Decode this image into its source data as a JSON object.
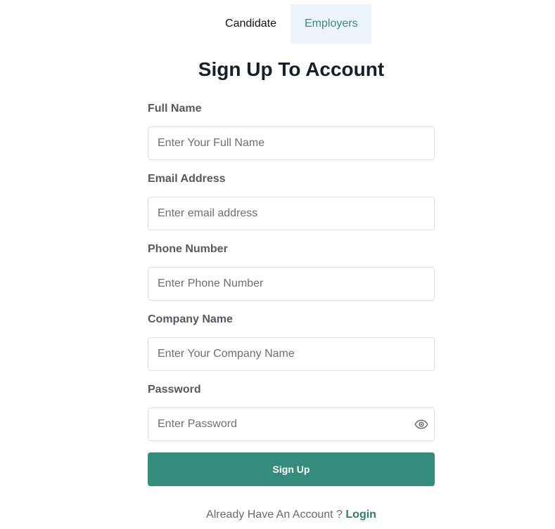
{
  "tabs": {
    "candidate": "Candidate",
    "employers": "Employers",
    "active_color": "#3a8a7a"
  },
  "title": "Sign Up To Account",
  "fields": {
    "full_name": {
      "label": "Full Name",
      "placeholder": "Enter Your Full Name"
    },
    "email": {
      "label": "Email Address",
      "placeholder": "Enter email address"
    },
    "phone": {
      "label": "Phone Number",
      "placeholder": "Enter Phone Number"
    },
    "company": {
      "label": "Company Name",
      "placeholder": "Enter Your Company Name"
    },
    "password": {
      "label": "Password",
      "placeholder": "Enter Password",
      "toggle_icon": "eye-icon"
    }
  },
  "submit": {
    "label": "Sign Up",
    "color": "#348c7c"
  },
  "footer": {
    "prompt": "Already Have An Account ?",
    "link": "Login",
    "link_color": "#2f7d6d"
  }
}
